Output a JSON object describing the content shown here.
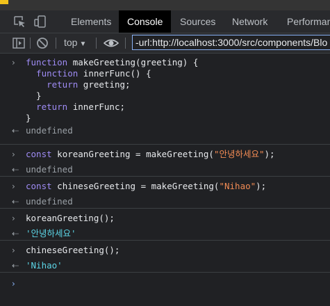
{
  "tabs": [
    "Elements",
    "Console",
    "Sources",
    "Network",
    "Performan"
  ],
  "active_tab": "Console",
  "toolbar": {
    "context": "top",
    "filter_value": "-url:http://localhost:3000/src/components/Blo"
  },
  "console": {
    "entry1": {
      "l1a": "function",
      "l1b": " makeGreeting(greeting) {",
      "l2a": "  function",
      "l2b": " innerFunc() {",
      "l3a": "    return",
      "l3b": " greeting;",
      "l4": "  }",
      "l5a": "  return",
      "l5b": " innerFunc;",
      "l6": "}",
      "result": "undefined"
    },
    "entry2": {
      "a": "const",
      "b": " koreanGreeting = makeGreeting(",
      "s": "\"안녕하세요\"",
      "c": ");",
      "result": "undefined"
    },
    "entry3": {
      "a": "const",
      "b": " chineseGreeting = makeGreeting(",
      "s": "\"Nihao\"",
      "c": ");",
      "result": "undefined"
    },
    "entry4": {
      "code": "koreanGreeting();",
      "result": "'안녕하세요'"
    },
    "entry5": {
      "code": "chineseGreeting();",
      "result": "'Nihao'"
    }
  },
  "glyphs": {
    "input": "›",
    "output": "⇠",
    "prompt": "›"
  },
  "colors": {
    "background": "#202124",
    "keyword": "#9f8cf5",
    "string": "#f28b54",
    "result_string": "#5cd5e6",
    "active_tab_bg": "#000000",
    "filter_border": "#8ab4f8"
  }
}
